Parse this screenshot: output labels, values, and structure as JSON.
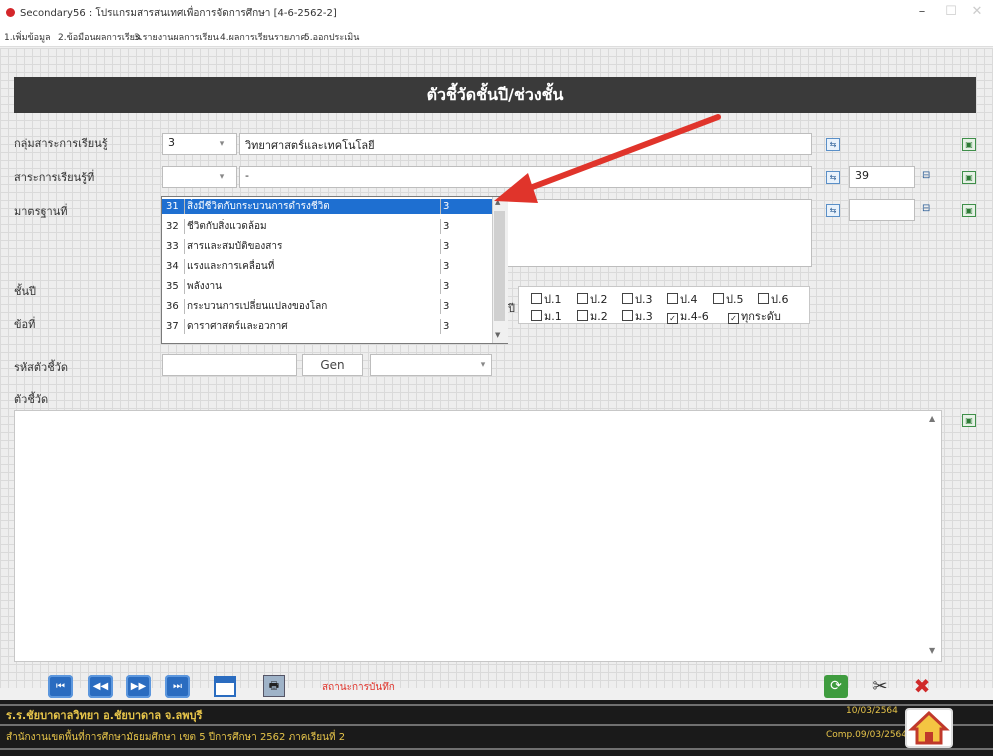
{
  "window": {
    "title": "Secondary56 : โปรแกรมสารสนเทศเพื่อการจัดการศึกษา [4-6-2562-2]",
    "menu": [
      "1.เพิ่มข้อมูล",
      "2.ข้อมือนผลการเรียน",
      "3.รายงานผลการเรียน",
      "4.ผลการเรียนรายภาค",
      "5.ออกประเมิน"
    ]
  },
  "header": {
    "title": "ตัวชี้วัดชั้นปี/ช่วงชั้น"
  },
  "form": {
    "group_label": "กลุ่มสาระการเรียนรู้",
    "group_code": "3",
    "group_name": "วิทยาศาสตร์และเทคโนโลยี",
    "strand_label": "สาระการเรียนรู้ที่",
    "strand_value": "-",
    "strand_count": "39",
    "standard_label": "มาตรฐานที่",
    "grade_label": "ชั้นปี",
    "level_label": "ข้อที่",
    "indicator_code_label": "รหัสตัวชี้วัด",
    "gen_button": "Gen",
    "indicator_label": "ตัวชี้วัด",
    "level_word": "ปี"
  },
  "dropdown": {
    "rows": [
      {
        "no": "31",
        "name": "สิ่งมีชีวิตกับกระบวนการดำรงชีวิต",
        "grp": "3",
        "selected": true
      },
      {
        "no": "32",
        "name": "ชีวิตกับสิ่งแวดล้อม",
        "grp": "3",
        "selected": false
      },
      {
        "no": "33",
        "name": "สารและสมบัติของสาร",
        "grp": "3",
        "selected": false
      },
      {
        "no": "34",
        "name": "แรงและการเคลื่อนที่",
        "grp": "3",
        "selected": false
      },
      {
        "no": "35",
        "name": "พลังงาน",
        "grp": "3",
        "selected": false
      },
      {
        "no": "36",
        "name": "กระบวนการเปลี่ยนแปลงของโลก",
        "grp": "3",
        "selected": false
      },
      {
        "no": "37",
        "name": "ดาราศาสตร์และอวกาศ",
        "grp": "3",
        "selected": false
      }
    ]
  },
  "grades": {
    "row1": [
      {
        "label": "ป.1",
        "checked": false
      },
      {
        "label": "ป.2",
        "checked": false
      },
      {
        "label": "ป.3",
        "checked": false
      },
      {
        "label": "ป.4",
        "checked": false
      },
      {
        "label": "ป.5",
        "checked": false
      },
      {
        "label": "ป.6",
        "checked": false
      }
    ],
    "row2": [
      {
        "label": "ม.1",
        "checked": false
      },
      {
        "label": "ม.2",
        "checked": false
      },
      {
        "label": "ม.3",
        "checked": false
      },
      {
        "label": "ม.4-6",
        "checked": true
      },
      {
        "label": "ทุกระดับ",
        "checked": true
      }
    ]
  },
  "toolbar": {
    "status": "สถานะการบันทึก"
  },
  "footer": {
    "school": "ร.ร.ชัยบาดาลวิทยา  อ.ชัยบาดาล  จ.ลพบุรี",
    "office": "สำนักงานเขตพื้นที่การศึกษามัธยมศึกษา เขต 5  ปีการศึกษา 2562  ภาคเรียนที่ 2",
    "date": "10/03/2564",
    "comp": "Comp.09/03/2564"
  },
  "colors": {
    "header_bg": "#3a3a3a",
    "accent_arrow": "#e0342b",
    "selection": "#1e6fd1",
    "footer_text": "#e7c54a"
  }
}
